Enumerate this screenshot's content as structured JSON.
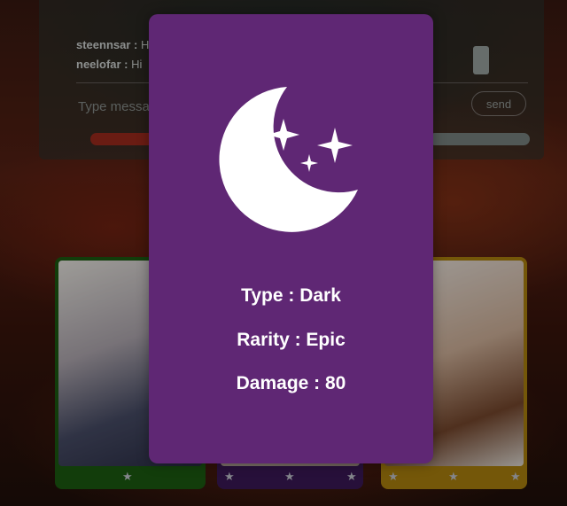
{
  "chat": {
    "messages": [
      {
        "user": "steennsar :",
        "text": "Hi"
      },
      {
        "user": "neelofar :",
        "text": "Hi"
      }
    ],
    "input_placeholder": "Type message",
    "send_label": "send"
  },
  "modal": {
    "icon": "moon-stars-icon",
    "type_label": "Type : Dark",
    "rarity_label": "Rarity : Epic",
    "damage_label": "Damage : 80"
  },
  "background_cards": [
    {
      "color": "#1d5e12",
      "stars": 1
    },
    {
      "color": "#3c1a5a",
      "stars": 3
    },
    {
      "color": "#b3860e",
      "stars": 3
    }
  ],
  "colors": {
    "modal_bg": "#5f2774",
    "text": "#ffffff"
  }
}
